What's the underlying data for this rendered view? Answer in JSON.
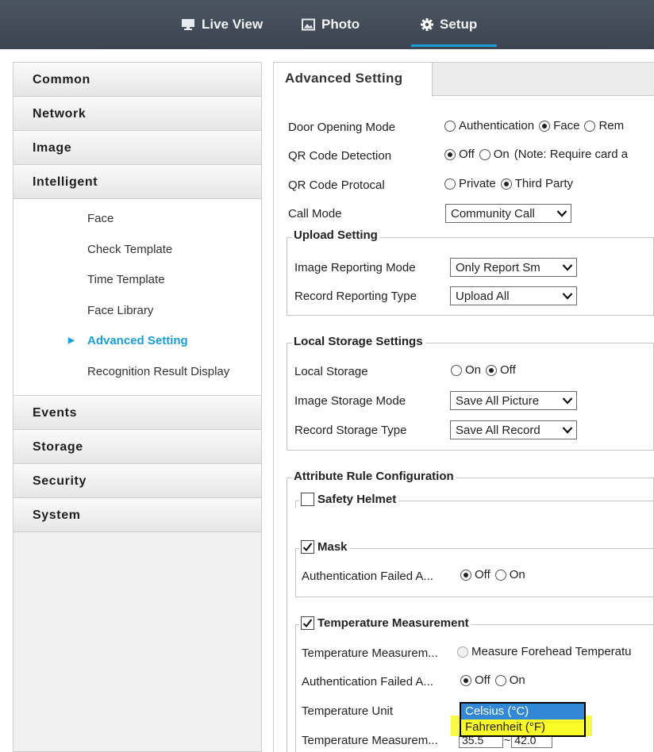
{
  "topnav": {
    "live_view": "Live View",
    "photo": "Photo",
    "setup": "Setup"
  },
  "sidebar": {
    "common": "Common",
    "network": "Network",
    "image": "Image",
    "intelligent": "Intelligent",
    "sub": {
      "face": "Face",
      "check_template": "Check Template",
      "time_template": "Time Template",
      "face_library": "Face Library",
      "advanced_setting": "Advanced Setting",
      "recognition_result_display": "Recognition Result Display"
    },
    "events": "Events",
    "storage": "Storage",
    "security": "Security",
    "system": "System"
  },
  "tab": {
    "label": "Advanced Setting"
  },
  "door_opening": {
    "label": "Door Opening Mode",
    "opt_auth": "Authentication",
    "opt_face": "Face",
    "opt_rem": "Rem",
    "selected": "Face"
  },
  "qr_detection": {
    "label": "QR Code Detection",
    "opt_off": "Off",
    "opt_on": "On",
    "note": "(Note: Require card a",
    "selected": "Off"
  },
  "qr_protocol": {
    "label": "QR Code Protocal",
    "opt_private": "Private",
    "opt_third": "Third Party",
    "selected": "Third Party"
  },
  "call_mode": {
    "label": "Call Mode",
    "value": "Community Call"
  },
  "upload": {
    "legend": "Upload Setting",
    "image_mode_label": "Image Reporting Mode",
    "image_mode_value": "Only Report Sm",
    "record_type_label": "Record Reporting Type",
    "record_type_value": "Upload All"
  },
  "local_storage": {
    "legend": "Local Storage Settings",
    "storage_label": "Local Storage",
    "opt_on": "On",
    "opt_off": "Off",
    "selected": "Off",
    "image_mode_label": "Image Storage Mode",
    "image_mode_value": "Save All Picture",
    "record_type_label": "Record Storage Type",
    "record_type_value": "Save All Record"
  },
  "attribute": {
    "legend": "Attribute Rule Configuration",
    "helmet_legend": "Safety Helmet",
    "helmet_checked": false,
    "mask_legend": "Mask",
    "mask_checked": true,
    "mask_auth_label": "Authentication Failed A...",
    "mask_opt_off": "Off",
    "mask_opt_on": "On",
    "mask_selected": "Off",
    "temp_legend": "Temperature Measurement",
    "temp_checked": true,
    "temp_measure_label": "Temperature Measurem...",
    "temp_measure_opt": "Measure Forehead Temperatu",
    "temp_auth_label": "Authentication Failed A...",
    "temp_opt_off": "Off",
    "temp_opt_on": "On",
    "temp_selected": "Off",
    "unit_label": "Temperature Unit",
    "unit_options": [
      "Celsius (°C)",
      "Fahrenheit (°F)"
    ],
    "unit_selected": "Celsius (°C)",
    "unit_highlighted": "Fahrenheit (°F)",
    "range_label": "Temperature Measurem...",
    "range_min": "35.5",
    "range_sep": "~",
    "range_max": "42.0"
  },
  "colors": {
    "topbar": "#424b56",
    "accent": "#1aa0d8",
    "dropdown_selected": "#3388d6",
    "highlight": "#fbfb2a"
  }
}
